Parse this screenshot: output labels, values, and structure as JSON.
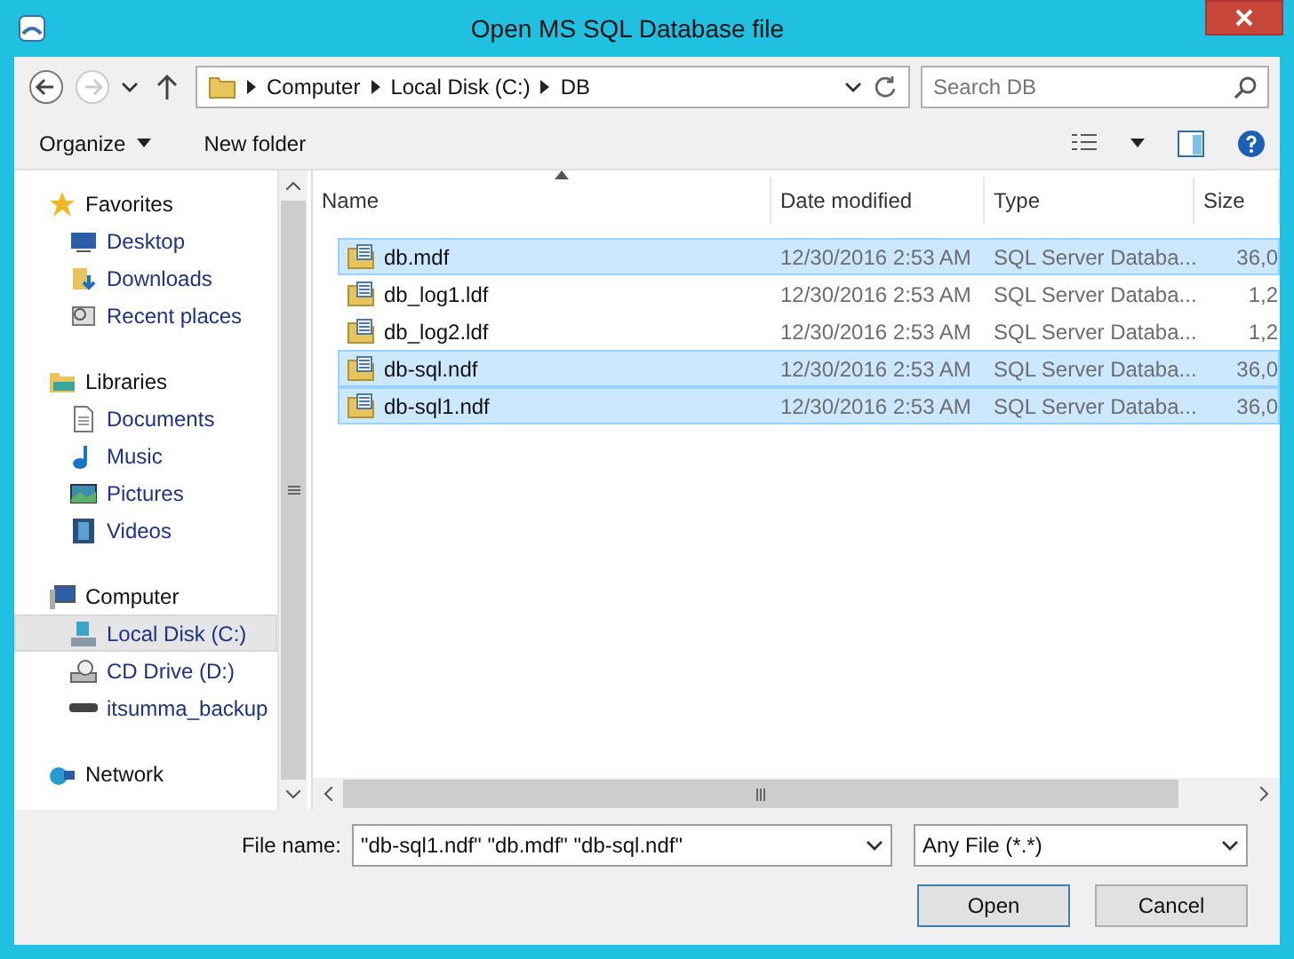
{
  "window": {
    "title": "Open MS SQL Database file"
  },
  "address": {
    "path": [
      "Computer",
      "Local Disk (C:)",
      "DB"
    ]
  },
  "search": {
    "placeholder": "Search DB"
  },
  "toolbar": {
    "organize": "Organize",
    "new_folder": "New folder"
  },
  "sidebar": {
    "items": [
      {
        "label": "Favorites",
        "selected": false,
        "children": [
          {
            "label": "Desktop",
            "selected": false
          },
          {
            "label": "Downloads",
            "selected": false
          },
          {
            "label": "Recent places",
            "selected": false
          }
        ]
      },
      {
        "label": "Libraries",
        "selected": false,
        "children": [
          {
            "label": "Documents",
            "selected": false
          },
          {
            "label": "Music",
            "selected": false
          },
          {
            "label": "Pictures",
            "selected": false
          },
          {
            "label": "Videos",
            "selected": false
          }
        ]
      },
      {
        "label": "Computer",
        "selected": false,
        "children": [
          {
            "label": "Local Disk (C:)",
            "selected": true
          },
          {
            "label": "CD Drive (D:)",
            "selected": false
          },
          {
            "label": "itsumma_backup",
            "selected": false
          }
        ]
      },
      {
        "label": "Network",
        "selected": false
      }
    ]
  },
  "table": {
    "columns": [
      "Name",
      "Date modified",
      "Type",
      "Size"
    ],
    "rows": [
      {
        "name": "db.mdf",
        "date": "12/30/2016 2:53 AM",
        "type": "SQL Server Databa...",
        "size": "36,0",
        "selected": true
      },
      {
        "name": "db_log1.ldf",
        "date": "12/30/2016 2:53 AM",
        "type": "SQL Server Databa...",
        "size": "1,2",
        "selected": false
      },
      {
        "name": "db_log2.ldf",
        "date": "12/30/2016 2:53 AM",
        "type": "SQL Server Databa...",
        "size": "1,2",
        "selected": false
      },
      {
        "name": "db-sql.ndf",
        "date": "12/30/2016 2:53 AM",
        "type": "SQL Server Databa...",
        "size": "36,0",
        "selected": true
      },
      {
        "name": "db-sql1.ndf",
        "date": "12/30/2016 2:53 AM",
        "type": "SQL Server Databa...",
        "size": "36,0",
        "selected": true
      }
    ]
  },
  "footer": {
    "file_name_label": "File name:",
    "file_name": "\"db-sql1.ndf\" \"db.mdf\" \"db-sql.ndf\"",
    "filter": "Any File (*.*)",
    "open": "Open",
    "cancel": "Cancel"
  }
}
